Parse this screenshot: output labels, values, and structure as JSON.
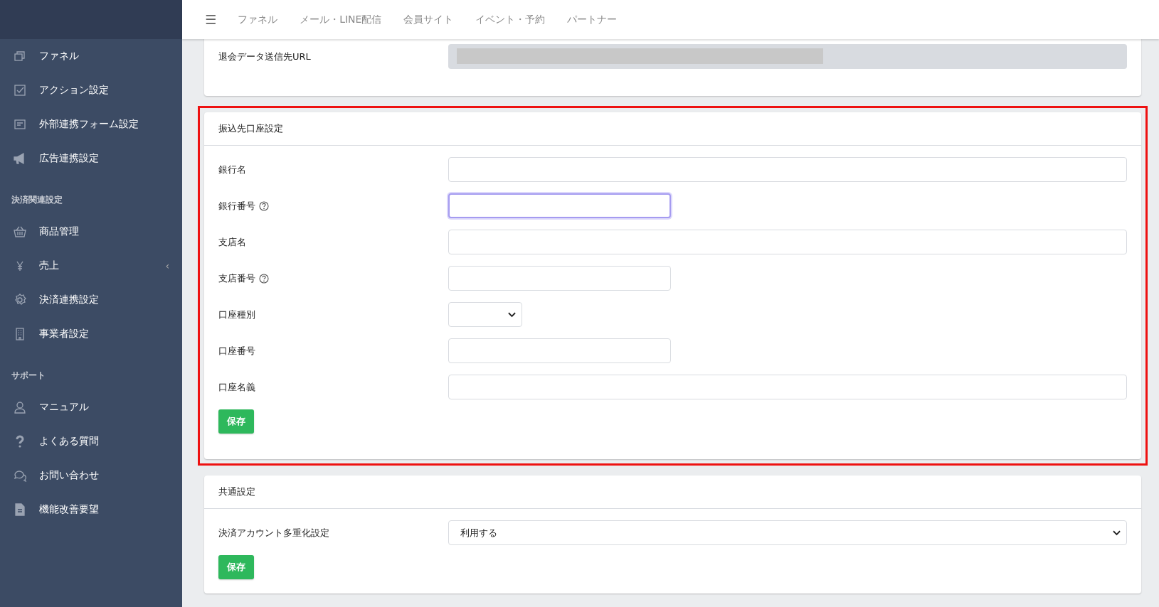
{
  "sidebar": {
    "sections": [
      {
        "items": [
          {
            "label": "ファネル"
          },
          {
            "label": "アクション設定"
          },
          {
            "label": "外部連携フォーム設定"
          },
          {
            "label": "広告連携設定"
          }
        ]
      },
      {
        "heading": "決済関連設定",
        "items": [
          {
            "label": "商品管理"
          },
          {
            "label": "売上",
            "caret": "‹"
          },
          {
            "label": "決済連携設定"
          },
          {
            "label": "事業者設定"
          }
        ]
      },
      {
        "heading": "サポート",
        "items": [
          {
            "label": "マニュアル"
          },
          {
            "label": "よくある質問"
          },
          {
            "label": "お問い合わせ"
          },
          {
            "label": "機能改善要望"
          }
        ]
      }
    ]
  },
  "topnav": {
    "menu_icon": "☰",
    "items": [
      "ファネル",
      "メール・LINE配信",
      "会員サイト",
      "イベント・予約",
      "パートナー"
    ]
  },
  "cards": [
    {
      "rows": [
        {
          "label": "退会データ送信先URL",
          "kind": "redacted"
        }
      ]
    },
    {
      "title": "振込先口座設定",
      "highlighted": true,
      "rows": [
        {
          "label": "銀行名",
          "kind": "wide",
          "focused": false
        },
        {
          "label": "銀行番号",
          "kind": "short",
          "help": true,
          "focused": true
        },
        {
          "label": "支店名",
          "kind": "wide",
          "focused": false
        },
        {
          "label": "支店番号",
          "kind": "short",
          "help": true,
          "focused": false
        },
        {
          "label": "口座種別",
          "kind": "picker"
        },
        {
          "label": "口座番号",
          "kind": "short",
          "focused": false
        },
        {
          "label": "口座名義",
          "kind": "wide",
          "focused": false
        }
      ],
      "button": "保存"
    },
    {
      "title": "共通設定",
      "highlighted": false,
      "rows": [
        {
          "label": "決済アカウント多重化設定",
          "kind": "dropdown",
          "value": "利用する"
        }
      ],
      "button": "保存"
    }
  ]
}
